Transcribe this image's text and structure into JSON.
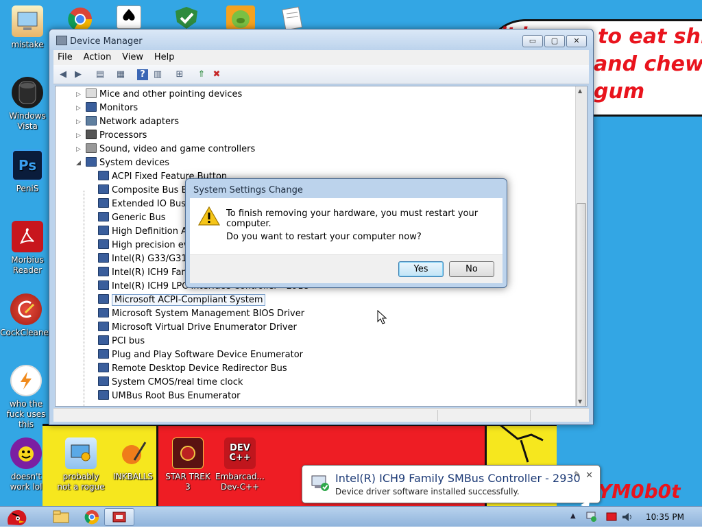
{
  "desktop": {
    "icons": [
      {
        "label": "mistake"
      },
      {
        "label": "Windows Vista"
      },
      {
        "label": "PeniS"
      },
      {
        "label": "Morbius Reader"
      },
      {
        "label": "CockCleaner"
      },
      {
        "label": "who the fuck uses this"
      },
      {
        "label": "doesn't work lol"
      },
      {
        "label": "probably not a rogue"
      },
      {
        "label": "INKBALLS"
      },
      {
        "label": "STAR TREK 3"
      },
      {
        "label": "Embarcad... Dev-C++"
      }
    ],
    "icon_texts": {
      "ps": "Ps",
      "dev": "DEV C++"
    },
    "wallpaper": {
      "line1": "to eat shit",
      "line2": "and chew",
      "line3": "gum",
      "partial": "it ha",
      "signature": "YM0b0t"
    }
  },
  "window": {
    "title": "Device Manager",
    "controls": {
      "minimize": "▭",
      "maximize": "▢",
      "close": "✕"
    },
    "menu": [
      "File",
      "Action",
      "View",
      "Help"
    ],
    "tree": {
      "categories": [
        "Mice and other pointing devices",
        "Monitors",
        "Network adapters",
        "Processors",
        "Sound, video and game controllers",
        "System devices"
      ],
      "system_devices": [
        "ACPI Fixed Feature Button",
        "Composite Bus Enumerator",
        "Extended IO Bus",
        "Generic Bus",
        "High Definition Audio Controller",
        "High precision event timer",
        "Intel(R) G33/G31/P35/P31 Express Chipset Processor to DRAM Controller - 29C0",
        "Intel(R) ICH9 Family SMBus Controller - 2930",
        "Intel(R) ICH9 LPC Interface Controller - 2918",
        "Microsoft ACPI-Compliant System",
        "Microsoft System Management BIOS Driver",
        "Microsoft Virtual Drive Enumerator Driver",
        "PCI bus",
        "Plug and Play Software Device Enumerator",
        "Remote Desktop Device Redirector Bus",
        "System CMOS/real time clock",
        "UMBus Root Bus Enumerator"
      ],
      "selected": "Microsoft ACPI-Compliant System"
    }
  },
  "dialog": {
    "title": "System Settings Change",
    "message": "To finish removing your hardware, you must restart your computer.",
    "question": "Do you want to restart your computer now?",
    "yes_label": "Yes",
    "no_label": "No"
  },
  "balloon": {
    "title": "Intel(R) ICH9 Family SMBus Controller - 2930",
    "subtitle": "Device driver software installed successfully.",
    "close": "✕"
  },
  "taskbar": {
    "time": "10:35 PM"
  },
  "colors": {
    "desktop": "#33a6e4",
    "window_frame": "#bcd3ec",
    "accent_text": "#1c3a76",
    "wallpaper_red": "#ee1d24",
    "wallpaper_yellow": "#f6e71e"
  }
}
